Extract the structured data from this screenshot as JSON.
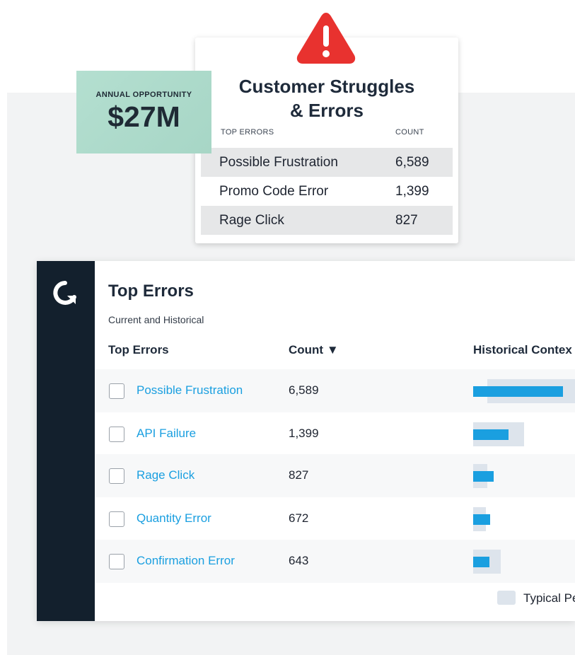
{
  "opportunity": {
    "label": "ANNUAL OPPORTUNITY",
    "value": "$27M"
  },
  "struggles": {
    "title_line1": "Customer Struggles",
    "title_line2": "& Errors",
    "col_errors": "TOP ERRORS",
    "col_count": "COUNT",
    "rows": [
      {
        "name": "Possible Frustration",
        "count": "6,589"
      },
      {
        "name": "Promo Code Error",
        "count": "1,399"
      },
      {
        "name": "Rage Click",
        "count": "827"
      }
    ]
  },
  "dashboard": {
    "title": "Top Errors",
    "subtitle": "Current and Historical",
    "col_errors": "Top Errors",
    "col_count": "Count ▼",
    "col_history": "Historical Contex",
    "rows": [
      {
        "name": "Possible Frustration",
        "count": "6,589",
        "current": 1.0,
        "typical": 1.0
      },
      {
        "name": "API Failure",
        "count": "1,399",
        "current": 0.39,
        "typical": 0.57
      },
      {
        "name": "Rage Click",
        "count": "827",
        "current": 0.23,
        "typical": 0.16
      },
      {
        "name": "Quantity Error",
        "count": "672",
        "current": 0.19,
        "typical": 0.14
      },
      {
        "name": "Confirmation Error",
        "count": "643",
        "current": 0.18,
        "typical": 0.31
      }
    ],
    "legend_typical": "Typical Pe"
  },
  "colors": {
    "accent": "#1a9fe0",
    "sidebar": "#13202d",
    "opportunity_bg": "#a7d6c6",
    "warning": "#e8322f"
  },
  "icons": {
    "warning": "warning-triangle-icon",
    "logo": "brand-logo-icon",
    "sort": "sort-descending-icon"
  }
}
